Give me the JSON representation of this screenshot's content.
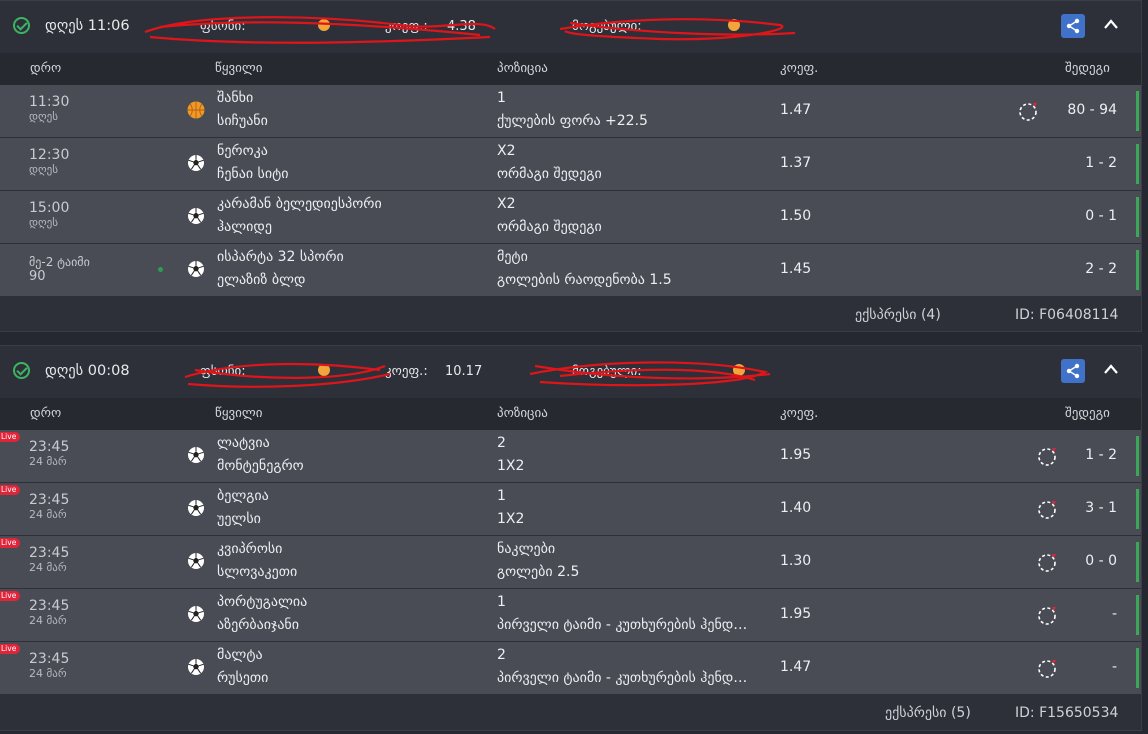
{
  "columns": {
    "time": "დრო",
    "pair": "წყვილი",
    "position": "პოზიცია",
    "odds": "კოეფ.",
    "results": "შედეგი"
  },
  "accent": {
    "success": "#3cb562",
    "live": "#e0253a",
    "share": "#3f72c8",
    "scribble": "#e0151a"
  },
  "bets": [
    {
      "header": {
        "date": "დღეს 11:06",
        "stake_label": "ფსონი:",
        "odds_label": "კოეფ.:",
        "odds_value": "4.38",
        "payout_label": "მოგებული:"
      },
      "footer": {
        "express": "ექსპრესი (4)",
        "id": "ID: F06408114"
      },
      "rows": [
        {
          "time": "11:30",
          "date": "დღეს",
          "sport": "basketball-icon",
          "team1": "შანხი",
          "team2": "სიჩუანი",
          "pick": "1",
          "market": "ქულების ფორა +22.5",
          "odds": "1.47",
          "result": "80 - 94"
        },
        {
          "time": "12:30",
          "date": "დღეს",
          "sport": "football-icon",
          "team1": "ნეროკა",
          "team2": "ჩენაი სიტი",
          "pick": "X2",
          "market": "ორმაგი შედეგი",
          "odds": "1.37",
          "result": "1 - 2"
        },
        {
          "time": "15:00",
          "date": "დღეს",
          "sport": "football-icon",
          "team1": "კარამან ბელედიესპორი",
          "team2": "ჰალიდე",
          "pick": "X2",
          "market": "ორმაგი შედეგი",
          "odds": "1.50",
          "result": "0 - 1"
        },
        {
          "time": "მე-2 ტაიმი",
          "date": "90",
          "sport": "football-icon",
          "team1": "ისპარტა 32 სპორი",
          "team2": "ელაზიზ ბლდ",
          "pick": "მეტი",
          "market": "გოლების რაოდენობა 1.5",
          "odds": "1.45",
          "result": "2 - 2"
        }
      ]
    },
    {
      "header": {
        "date": "დღეს 00:08",
        "stake_label": "ფსონი:",
        "odds_label": "კოეფ.:",
        "odds_value": "10.17",
        "payout_label": "მოგებული:"
      },
      "footer": {
        "express": "ექსპრესი (5)",
        "id": "ID: F15650534"
      },
      "rows": [
        {
          "live": "Live",
          "time": "23:45",
          "date": "24 მარ",
          "sport": "football-icon",
          "team1": "ლატვია",
          "team2": "მონტენეგრო",
          "pick": "2",
          "market": "1X2",
          "odds": "1.95",
          "result": "1 - 2"
        },
        {
          "live": "Live",
          "time": "23:45",
          "date": "24 მარ",
          "sport": "football-icon",
          "team1": "ბელგია",
          "team2": "უელსი",
          "pick": "1",
          "market": "1X2",
          "odds": "1.40",
          "result": "3 - 1"
        },
        {
          "live": "Live",
          "time": "23:45",
          "date": "24 მარ",
          "sport": "football-icon",
          "team1": "კვიპროსი",
          "team2": "სლოვაკეთი",
          "pick": "ნაკლები",
          "market": "გოლები 2.5",
          "odds": "1.30",
          "result": "0 - 0"
        },
        {
          "live": "Live",
          "time": "23:45",
          "date": "24 მარ",
          "sport": "football-icon",
          "team1": "პორტუგალია",
          "team2": "აზერბაიჯანი",
          "pick": "1",
          "market": "პირველი ტაიმი - კუთხურების ჰენდიკაპი",
          "odds": "1.95",
          "result": "-"
        },
        {
          "live": "Live",
          "time": "23:45",
          "date": "24 მარ",
          "sport": "football-icon",
          "team1": "მალტა",
          "team2": "რუსეთი",
          "pick": "2",
          "market": "პირველი ტაიმი - კუთხურების ჰენდიკაპი",
          "odds": "1.47",
          "result": "-"
        }
      ]
    }
  ]
}
